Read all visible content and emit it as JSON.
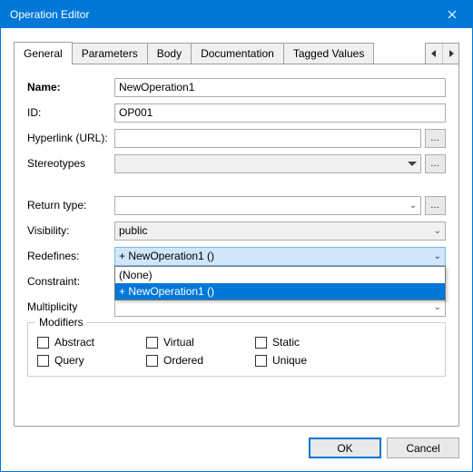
{
  "window": {
    "title": "Operation Editor"
  },
  "tabs": {
    "items": [
      "General",
      "Parameters",
      "Body",
      "Documentation",
      "Tagged Values"
    ],
    "active_index": 0
  },
  "form": {
    "name": {
      "label": "Name:",
      "value": "NewOperation1"
    },
    "id": {
      "label": "ID:",
      "value": "OP001"
    },
    "hyperlink": {
      "label": "Hyperlink (URL):",
      "value": ""
    },
    "stereotypes": {
      "label": "Stereotypes",
      "value": ""
    },
    "return_type": {
      "label": "Return type:",
      "value": ""
    },
    "visibility": {
      "label": "Visibility:",
      "value": "public"
    },
    "redefines": {
      "label": "Redefines:",
      "value": "+ NewOperation1 ()",
      "options": [
        "(None)",
        "+ NewOperation1 ()"
      ]
    },
    "constraint": {
      "label": "Constraint:",
      "value": ""
    },
    "multiplicity": {
      "label": "Multiplicity",
      "value": ""
    }
  },
  "modifiers": {
    "legend": "Modifiers",
    "row1": [
      "Abstract",
      "Virtual",
      "Static"
    ],
    "row2": [
      "Query",
      "Ordered",
      "Unique"
    ]
  },
  "buttons": {
    "ok": "OK",
    "cancel": "Cancel"
  }
}
